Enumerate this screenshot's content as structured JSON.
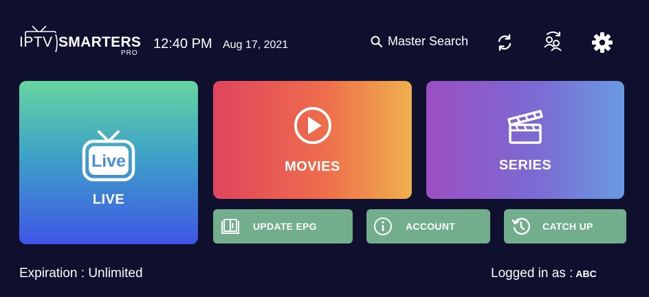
{
  "header": {
    "logo": {
      "iptv": "IPTV",
      "smarters": "SMARTERS",
      "pro": "PRO"
    },
    "time": "12:40 PM",
    "date": "Aug 17, 2021",
    "search_label": "Master Search"
  },
  "tiles": {
    "live_icon_text": "Live",
    "live_label": "LIVE",
    "movies_label": "MOVIES",
    "series_label": "SERIES"
  },
  "buttons": {
    "update_epg": "UPDATE EPG",
    "account": "ACCOUNT",
    "catch_up": "CATCH UP"
  },
  "footer": {
    "expiration": "Expiration : Unlimited",
    "logged_in_label": "Logged in as :",
    "user": "ABC"
  },
  "colors": {
    "background": "#0f0f2e",
    "button_green": "#72ad8c",
    "movies_gradient": [
      "#e0455e",
      "#f0b04e"
    ],
    "series_gradient": [
      "#9b4fc4",
      "#6a9ae2"
    ],
    "live_gradient": [
      "#67d5a0",
      "#3f55e6"
    ]
  },
  "icons": [
    "tv-antenna-icon",
    "search-icon",
    "refresh-icon",
    "switch-user-icon",
    "gear-icon",
    "live-tv-icon",
    "play-circle-icon",
    "clapperboard-icon",
    "book-icon",
    "info-icon",
    "history-icon"
  ]
}
